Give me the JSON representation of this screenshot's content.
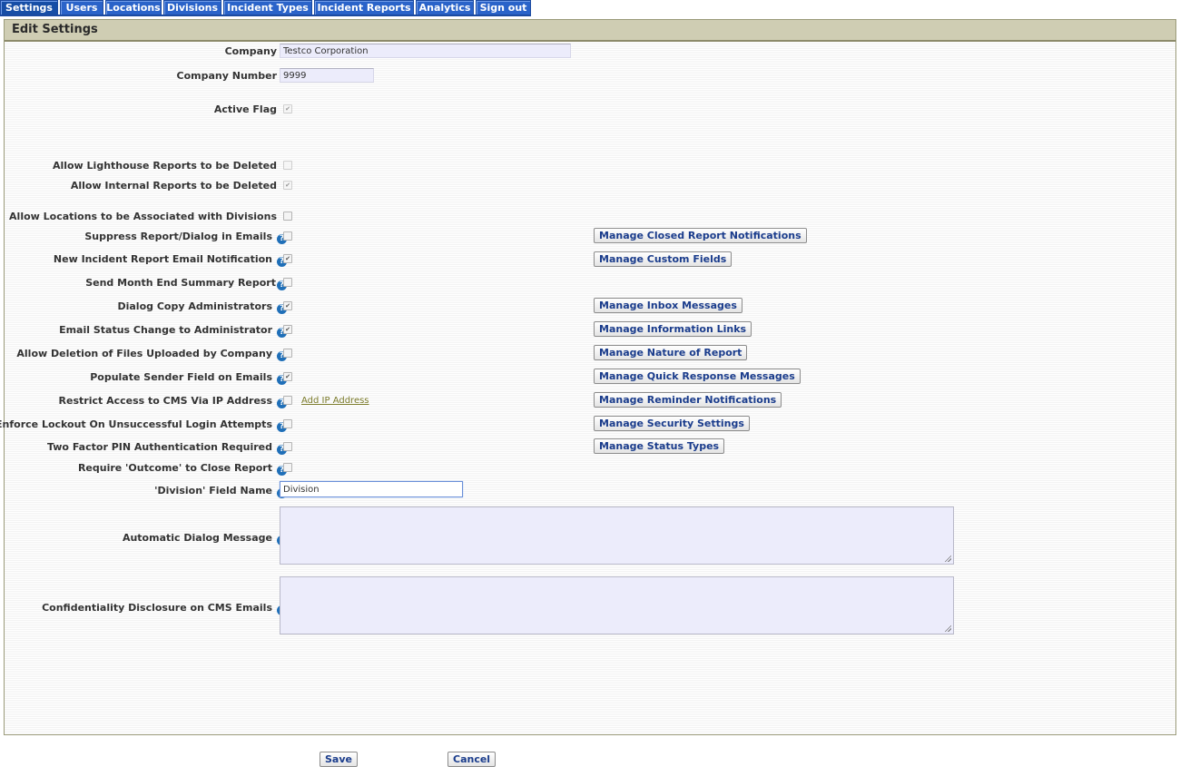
{
  "tabs": [
    "Settings",
    "Users",
    "Locations",
    "Divisions",
    "Incident Types",
    "Incident Reports",
    "Analytics",
    "Sign out"
  ],
  "panel_title": "Edit Settings",
  "company": {
    "label": "Company",
    "value": "Testco Corporation"
  },
  "company_number": {
    "label": "Company Number",
    "value": "9999"
  },
  "active_flag": {
    "label": "Active Flag",
    "checked": true
  },
  "settings": [
    {
      "label": "Allow Lighthouse Reports to be Deleted",
      "help": false,
      "checked": false
    },
    {
      "label": "Allow Internal Reports to be Deleted",
      "help": false,
      "checked": true
    },
    {
      "label": "Allow Locations to be Associated with Divisions",
      "help": false,
      "checked": false
    },
    {
      "label": "Suppress Report/Dialog in Emails",
      "help": true,
      "checked": false
    },
    {
      "label": "New Incident Report Email Notification",
      "help": true,
      "checked": true
    },
    {
      "label": "Send Month End Summary Report",
      "help": true,
      "checked": false
    },
    {
      "label": "Dialog Copy Administrators",
      "help": true,
      "checked": true
    },
    {
      "label": "Email Status Change to Administrator",
      "help": true,
      "checked": true
    },
    {
      "label": "Allow Deletion of Files Uploaded by Company",
      "help": true,
      "checked": false
    },
    {
      "label": "Populate Sender Field on Emails",
      "help": true,
      "checked": true
    },
    {
      "label": "Restrict Access to CMS Via IP Address",
      "help": true,
      "checked": false
    },
    {
      "label": "Enforce Lockout On Unsuccessful Login Attempts",
      "help": true,
      "checked": false
    },
    {
      "label": "Two Factor PIN Authentication Required",
      "help": true,
      "checked": false
    },
    {
      "label": "Require 'Outcome' to Close Report",
      "help": true,
      "checked": false
    }
  ],
  "add_ip_link": "Add IP Address",
  "division_field": {
    "label": "'Division' Field Name",
    "value": "Division"
  },
  "auto_dialog": {
    "label": "Automatic Dialog Message"
  },
  "confidentiality": {
    "label": "Confidentiality Disclosure on CMS Emails"
  },
  "manage_buttons": [
    "Manage Closed Report Notifications",
    "Manage Custom Fields",
    "Manage Inbox Messages",
    "Manage Information Links",
    "Manage Nature of Report",
    "Manage Quick Response Messages",
    "Manage Reminder Notifications",
    "Manage Security Settings",
    "Manage Status Types"
  ],
  "footer": {
    "save": "Save",
    "cancel": "Cancel"
  },
  "help_icon_glyph": "?"
}
